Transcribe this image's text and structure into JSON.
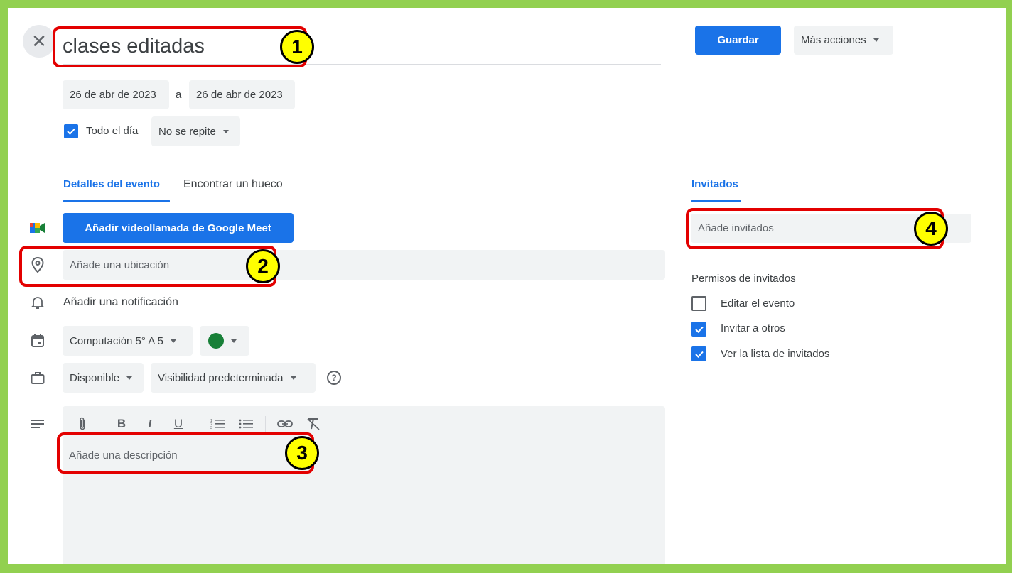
{
  "header": {
    "close_icon": "close-icon",
    "title_value": "clases editadas",
    "save_label": "Guardar",
    "more_actions_label": "Más acciones"
  },
  "dates": {
    "start": "26 de abr de 2023",
    "separator": "a",
    "end": "26 de abr de 2023",
    "all_day_label": "Todo el día",
    "all_day_checked": true,
    "repeat_value": "No se repite"
  },
  "tabs": {
    "details": "Detalles del evento",
    "find_slot": "Encontrar un hueco",
    "guests": "Invitados"
  },
  "details": {
    "meet_button": "Añadir videollamada de Google Meet",
    "location_placeholder": "Añade una ubicación",
    "notification_label": "Añadir una notificación",
    "calendar_value": "Computación 5° A 5",
    "event_color": "#188038",
    "availability_value": "Disponible",
    "visibility_value": "Visibilidad predeterminada",
    "description_placeholder": "Añade una descripción"
  },
  "toolbar": {
    "attach_icon": "paperclip-icon",
    "bold": "B",
    "italic": "I",
    "underline": "U",
    "numbered_icon": "numbered-list-icon",
    "bulleted_icon": "bulleted-list-icon",
    "link_icon": "link-icon",
    "clear_icon": "clear-format-icon"
  },
  "guests": {
    "add_placeholder": "Añade invitados",
    "permissions_title": "Permisos de invitados",
    "permissions": [
      {
        "label": "Editar el evento",
        "checked": false
      },
      {
        "label": "Invitar a otros",
        "checked": true
      },
      {
        "label": "Ver la lista de invitados",
        "checked": true
      }
    ]
  },
  "annotations": {
    "n1": "1",
    "n2": "2",
    "n3": "3",
    "n4": "4"
  },
  "colors": {
    "accent": "#1a73e8",
    "frame": "#92d050",
    "highlight": "#e30000",
    "badge": "#ffff00"
  }
}
